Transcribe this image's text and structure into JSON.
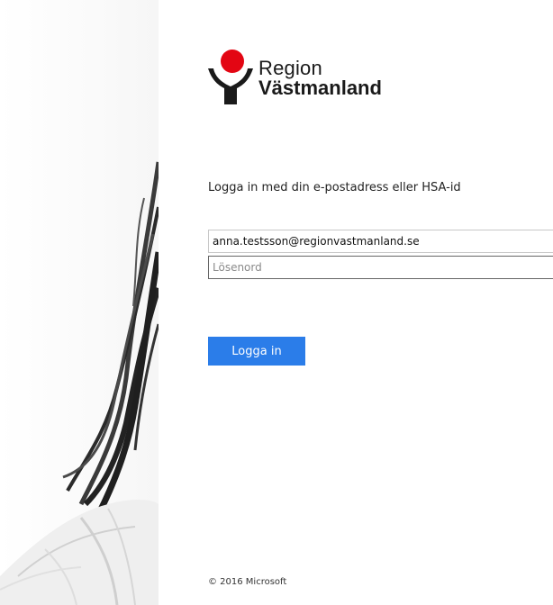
{
  "brand": {
    "name_line1": "Region",
    "name_line2": "Västmanland",
    "colors": {
      "red": "#e30613",
      "dark": "#1a1a1a"
    }
  },
  "login": {
    "heading": "Logga in med din e-postadress eller HSA-id",
    "email_value": "anna.testsson@regionvastmanland.se",
    "password_placeholder": "Lösenord",
    "submit_label": "Logga in",
    "button_color": "#2b7de9"
  },
  "footer": {
    "copyright": "© 2016 Microsoft"
  }
}
